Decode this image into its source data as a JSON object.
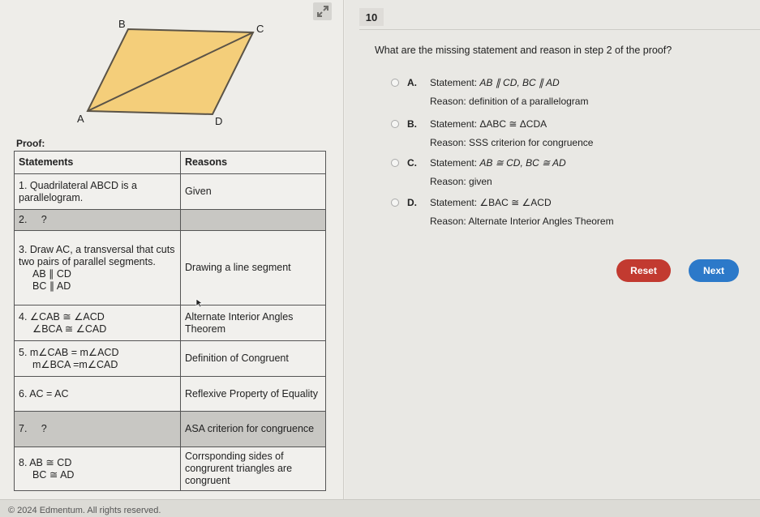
{
  "figure": {
    "vertex_labels": {
      "A": "A",
      "B": "B",
      "C": "C",
      "D": "D"
    },
    "fill_color": "#f4ce7a",
    "stroke_color": "#5a5347"
  },
  "proof": {
    "label": "Proof:",
    "headers": {
      "statements": "Statements",
      "reasons": "Reasons"
    },
    "rows": [
      {
        "lines": [
          "1. Quadrilateral ABCD is a parallelogram."
        ],
        "reason": "Given"
      },
      {
        "lines": [
          "2.     ?"
        ],
        "reason": ""
      },
      {
        "lines": [
          "3. Draw AC, a transversal that cuts two pairs of parallel segments."
        ],
        "sub": [
          "AB ∥ CD",
          "BC ∥ AD"
        ],
        "reason": "Drawing a line segment"
      },
      {
        "lines": [
          "4. ∠CAB ≅ ∠ACD"
        ],
        "sub": [
          "∠BCA ≅ ∠CAD"
        ],
        "reason": "Alternate Interior Angles Theorem"
      },
      {
        "lines": [
          "5. m∠CAB = m∠ACD"
        ],
        "sub": [
          "m∠BCA =m∠CAD"
        ],
        "reason": "Definition of Congruent"
      },
      {
        "lines": [
          "6. AC = AC"
        ],
        "reason": "Reflexive Property of Equality"
      },
      {
        "lines": [
          "7.     ?"
        ],
        "reason": "ASA criterion for congruence"
      },
      {
        "lines": [
          "8. AB ≅ CD"
        ],
        "sub": [
          "BC ≅ AD"
        ],
        "reason": "Corrsponding sides of congrurent triangles are congruent"
      }
    ]
  },
  "question": {
    "number": "10",
    "text": "What are the missing statement and reason in step 2 of the proof?",
    "options": [
      {
        "letter": "A.",
        "statement_prefix": "Statement: ",
        "statement": "AB ∥ CD, BC ∥ AD",
        "reason": "Reason: definition of a parallelogram"
      },
      {
        "letter": "B.",
        "statement_prefix": "Statement: ",
        "statement": "ΔABC ≅ ΔCDA",
        "reason": "Reason: SSS criterion for congruence"
      },
      {
        "letter": "C.",
        "statement_prefix": "Statement: ",
        "statement": "AB ≅ CD, BC ≅ AD",
        "reason": "Reason: given"
      },
      {
        "letter": "D.",
        "statement_prefix": "Statement: ",
        "statement": "∠BAC ≅ ∠ACD",
        "reason": "Reason: Alternate Interior Angles Theorem"
      }
    ]
  },
  "buttons": {
    "reset": "Reset",
    "next": "Next"
  },
  "footer": {
    "copyright": "© 2024 Edmentum. All rights reserved."
  },
  "colors": {
    "reset": "#c23a30",
    "next": "#2c79c9"
  }
}
